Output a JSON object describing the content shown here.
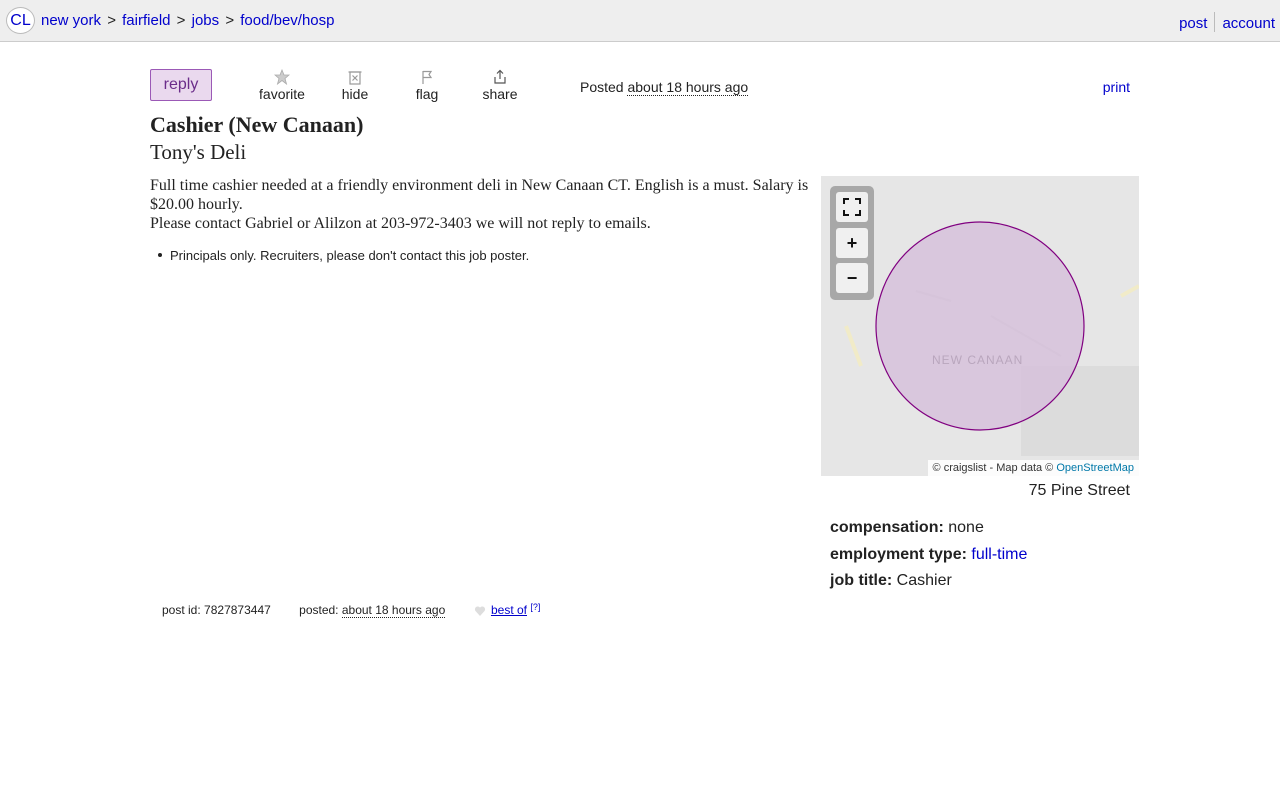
{
  "topbar": {
    "logo": "CL",
    "breadcrumbs": [
      "new york",
      "fairfield",
      "jobs",
      "food/bev/hosp"
    ],
    "separator": ">",
    "post_link": "post",
    "account_link": "account"
  },
  "actions": {
    "reply": "reply",
    "favorite": "favorite",
    "hide": "hide",
    "flag": "flag",
    "share": "share",
    "posted_prefix": "Posted",
    "posted_time": "about 18 hours ago",
    "print": "print"
  },
  "posting": {
    "title": "Cashier (New Canaan)",
    "business": "Tony's Deli",
    "body_line1": "Full time cashier needed at a friendly environment deli in New Canaan CT. English is a must. Salary is $20.00 hourly.",
    "body_line2": "Please contact Gabriel or Alilzon at 203-972-3403 we will not reply to emails.",
    "notice": "Principals only. Recruiters, please don't contact this job poster."
  },
  "map": {
    "city_label": "NEW CANAAN",
    "attribution_prefix": "© craigslist - Map data ©",
    "attribution_link": "OpenStreetMap",
    "expand_icon": "fullscreen-icon",
    "zoom_in": "+",
    "zoom_out": "−",
    "area_color": "#d6c1da",
    "area_stroke": "#800080"
  },
  "address": "75 Pine Street",
  "attributes": [
    {
      "label": "compensation:",
      "value": "none",
      "is_link": false
    },
    {
      "label": "employment type:",
      "value": "full-time",
      "is_link": true
    },
    {
      "label": "job title:",
      "value": "Cashier",
      "is_link": false
    }
  ],
  "footer": {
    "post_id_label": "post id:",
    "post_id": "7827873447",
    "posted_label": "posted:",
    "posted_time": "about 18 hours ago",
    "best_of": "best of",
    "help": "[?]"
  },
  "colors": {
    "link": "#0000cc",
    "reply_bg": "#ead9ee",
    "reply_text": "#6b2d8a",
    "topbar_bg": "#eeeeee"
  }
}
